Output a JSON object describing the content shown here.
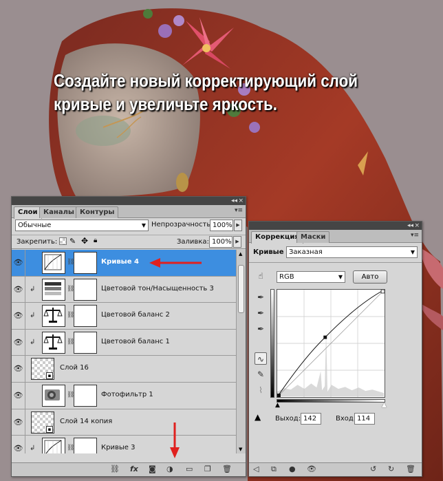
{
  "caption": {
    "line1": "Создайте новый корректирующий слой",
    "line2": "кривые и увеличьте яркость."
  },
  "layers_panel": {
    "tabs": [
      "Слои",
      "Каналы",
      "Контуры"
    ],
    "blend_mode": "Обычные",
    "opacity_label": "Непрозрачность:",
    "opacity_value": "100%",
    "lock_label": "Закрепить:",
    "fill_label": "Заливка:",
    "fill_value": "100%",
    "layers": [
      {
        "name": "Кривые 4",
        "type": "curves",
        "selected": true,
        "clipped": false
      },
      {
        "name": "Цветовой тон/Насыщенность 3",
        "type": "huesat",
        "selected": false,
        "clipped": true
      },
      {
        "name": "Цветовой баланс 2",
        "type": "balance",
        "selected": false,
        "clipped": true
      },
      {
        "name": "Цветовой баланс 1",
        "type": "balance",
        "selected": false,
        "clipped": true
      },
      {
        "name": "Слой 16",
        "type": "pixel",
        "selected": false,
        "clipped": false
      },
      {
        "name": "Фотофильтр 1",
        "type": "photofilter",
        "selected": false,
        "clipped": false
      },
      {
        "name": "Слой 14 копия",
        "type": "pixel",
        "selected": false,
        "clipped": false
      },
      {
        "name": "Кривые 3",
        "type": "curves",
        "selected": false,
        "clipped": true
      }
    ],
    "bottom_icons": [
      "link-icon",
      "fx-icon",
      "mask-icon",
      "adjustment-icon",
      "folder-icon",
      "new-layer-icon",
      "trash-icon"
    ]
  },
  "correction_panel": {
    "tabs": [
      "Коррекция",
      "Маски"
    ],
    "adjustment_label": "Кривые",
    "preset": "Заказная",
    "channel": "RGB",
    "auto_label": "Авто",
    "output_label": "Выход:",
    "output_value": "142",
    "input_label": "Вход:",
    "input_value": "114",
    "curve_point": {
      "input": 114,
      "output": 142
    }
  },
  "colors": {
    "selected_layer": "#3d8ee0",
    "panel": "#d6d6d6",
    "titlebar": "#454545",
    "annotation_arrow": "#e0201e"
  }
}
